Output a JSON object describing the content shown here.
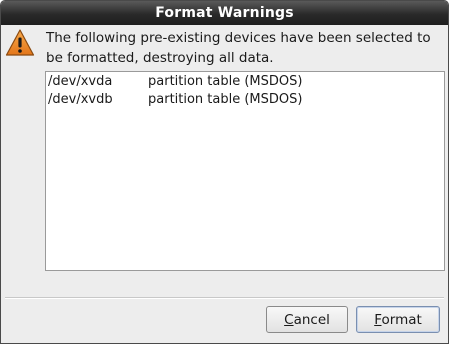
{
  "dialog": {
    "title": "Format Warnings",
    "icon": "warning-triangle-icon",
    "message": "The following pre-existing devices have been selected to be formatted, destroying all data."
  },
  "devices": [
    {
      "name": "/dev/xvda",
      "description": "partition table (MSDOS)"
    },
    {
      "name": "/dev/xvdb",
      "description": "partition table (MSDOS)"
    }
  ],
  "buttons": {
    "cancel": {
      "mnemonic": "C",
      "rest": "ancel"
    },
    "format": {
      "mnemonic": "F",
      "rest": "ormat"
    }
  },
  "colors": {
    "warning_fill": "#f0891c",
    "titlebar": "#2a2a2a"
  }
}
